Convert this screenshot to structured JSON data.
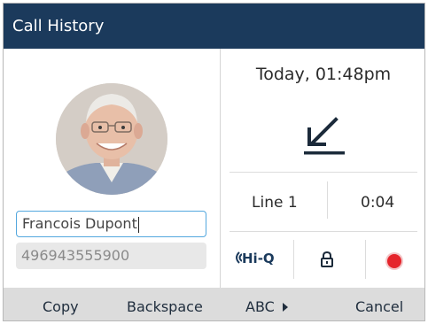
{
  "header": {
    "title": "Call History"
  },
  "contact": {
    "name_value": "Francois Dupont",
    "number_value": "496943555900"
  },
  "call": {
    "datetime": "Today, 01:48pm",
    "direction_icon": "incoming-call-arrow-icon",
    "line": "Line 1",
    "duration": "0:04",
    "hiq_label": "Hi-Q",
    "lock_icon": "lock-icon",
    "record_icon": "record-icon",
    "record_color": "#e5242b"
  },
  "softkeys": {
    "copy": "Copy",
    "backspace": "Backspace",
    "abc": "ABC",
    "cancel": "Cancel"
  },
  "colors": {
    "titlebar": "#1b3a5c",
    "input_focus_border": "#53a7de",
    "softkey_bar": "#dcdcdc"
  }
}
